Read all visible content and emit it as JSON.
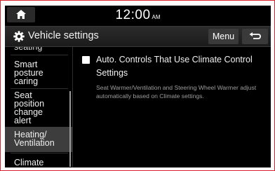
{
  "status_bar": {
    "time": "12:00",
    "ampm": "AM"
  },
  "header": {
    "title": "Vehicle settings",
    "menu_label": "Menu"
  },
  "sidebar": {
    "items": [
      {
        "label": "seating"
      },
      {
        "label": "Smart posture caring"
      },
      {
        "label": "Seat position change alert"
      },
      {
        "label": "Heating/ Ventilation"
      },
      {
        "label": "Climate"
      }
    ]
  },
  "option": {
    "title": "Auto. Controls That Use Climate Control Settings",
    "description": "Seat Warmer/Ventilation and Steering Wheel Warmer adjust automatically based on Climate settings.",
    "checked": false
  }
}
